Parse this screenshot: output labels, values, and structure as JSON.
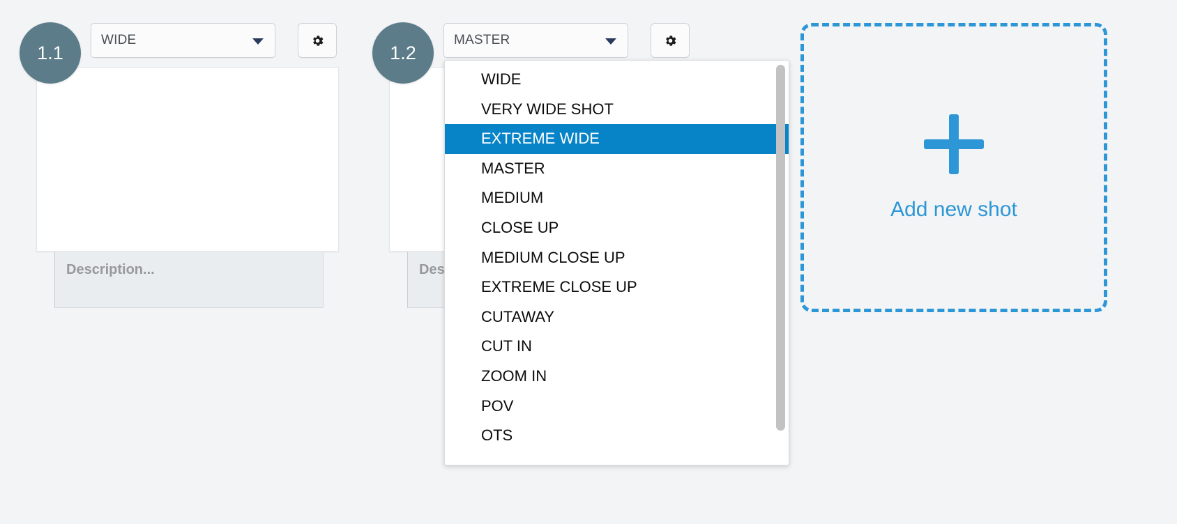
{
  "page": {
    "background_color": "#f2f4f6",
    "accent_blue": "#2d96d6",
    "highlight_blue": "#0783c8",
    "badge_color": "#5c7c8a"
  },
  "shots": [
    {
      "badge": "1.1",
      "shot_type": "WIDE",
      "description_placeholder": "Description...",
      "settings_icon": "gear-icon",
      "caret_icon": "chevron-down-icon"
    },
    {
      "badge": "1.2",
      "shot_type": "MASTER",
      "description_placeholder": "Description...",
      "settings_icon": "gear-icon",
      "caret_icon": "chevron-down-icon"
    }
  ],
  "dropdown": {
    "open_for_shot": "1.2",
    "selected": "EXTREME WIDE",
    "options": [
      "WIDE",
      "VERY WIDE SHOT",
      "EXTREME WIDE",
      "MASTER",
      "MEDIUM",
      "CLOSE UP",
      "MEDIUM CLOSE UP",
      "EXTREME CLOSE UP",
      "CUTAWAY",
      "CUT IN",
      "ZOOM IN",
      "POV",
      "OTS"
    ],
    "scrollbar": {
      "visible": true
    }
  },
  "add_shot": {
    "label": "Add new shot",
    "icon": "plus-icon"
  }
}
